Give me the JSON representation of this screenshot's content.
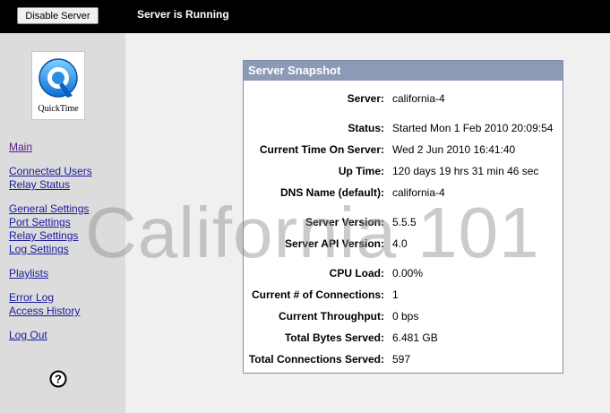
{
  "topbar": {
    "disable_button": "Disable Server",
    "status": "Server is Running"
  },
  "logo": {
    "text": "QuickTime"
  },
  "nav": {
    "main": "Main",
    "connected_users": "Connected Users",
    "relay_status": "Relay Status",
    "general_settings": "General Settings",
    "port_settings": "Port Settings",
    "relay_settings": "Relay Settings",
    "log_settings": "Log Settings",
    "playlists": "Playlists",
    "error_log": "Error Log",
    "access_history": "Access History",
    "log_out": "Log Out"
  },
  "watermark": "California 101",
  "panel": {
    "title": "Server Snapshot",
    "rows": [
      {
        "label": "Server:",
        "value": "california-4"
      },
      {
        "label": "Status:",
        "value": "Started Mon 1 Feb 2010 20:09:54"
      },
      {
        "label": "Current Time On Server:",
        "value": "Wed 2 Jun 2010 16:41:40"
      },
      {
        "label": "Up Time:",
        "value": "120 days 19 hrs 31 min 46 sec"
      },
      {
        "label": "DNS Name (default):",
        "value": "california-4"
      },
      {
        "label": "Server Version:",
        "value": "5.5.5"
      },
      {
        "label": "Server API Version:",
        "value": "4.0"
      },
      {
        "label": "CPU Load:",
        "value": "0.00%"
      },
      {
        "label": "Current # of Connections:",
        "value": "1"
      },
      {
        "label": "Current Throughput:",
        "value": "0 bps"
      },
      {
        "label": "Total Bytes Served:",
        "value": "6.481 GB"
      },
      {
        "label": "Total Connections Served:",
        "value": "597"
      }
    ]
  },
  "colors": {
    "topbar": "#000000",
    "panel_header": "#8c9ab5",
    "link": "#1a1aa0",
    "visited_link": "#551a8b"
  },
  "icons": {
    "logo": "quicktime-logo-icon",
    "help": "help-icon"
  }
}
